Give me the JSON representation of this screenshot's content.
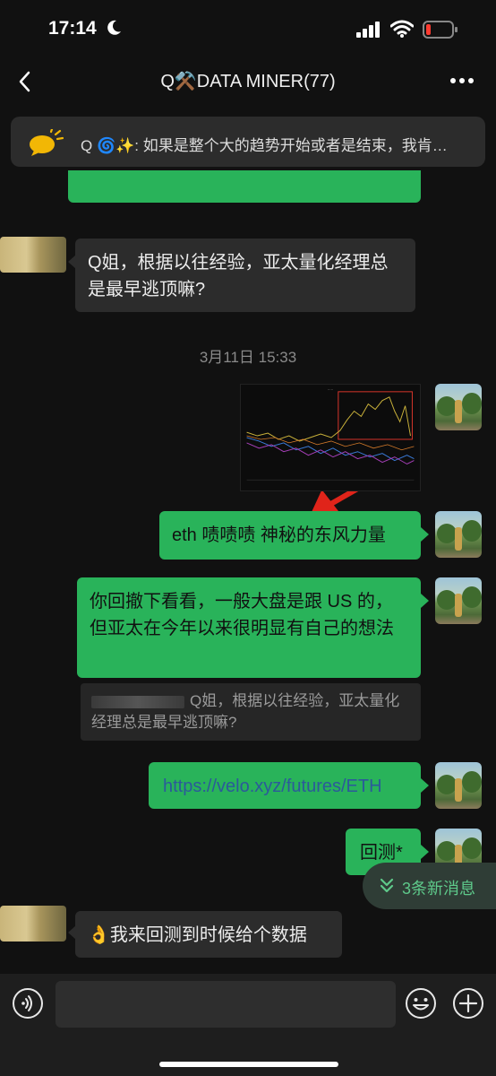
{
  "status_bar": {
    "time": "17:14",
    "battery_color": "#ff3b30"
  },
  "header": {
    "title": "Q⚒️DATA MINER(77)"
  },
  "announcement": {
    "text": "Q 🌀✨: 如果是整个大的趋势开始或者是结束，我肯…"
  },
  "messages": [
    {
      "side": "in",
      "text": "Q姐，根据以往经验，亚太量化经理总是最早逃顶嘛?"
    },
    {
      "type": "timestamp",
      "text": "3月11日 15:33"
    },
    {
      "side": "out",
      "type": "image",
      "icon": "chart-image"
    },
    {
      "side": "out",
      "text": "eth 啧啧啧 神秘的东风力量"
    },
    {
      "side": "out",
      "text": "你回撤下看看，一般大盘是跟 US 的，但亚太在今年以来很明显有自己的想法"
    },
    {
      "type": "quote",
      "text": "Q姐，根据以往经验，亚太量化经理总是最早逃顶嘛?"
    },
    {
      "side": "out",
      "type": "link",
      "text": "https://velo.xyz/futures/ETH"
    },
    {
      "side": "out",
      "text": "回测*"
    },
    {
      "side": "in",
      "text": "👌我来回测到时候给个数据"
    }
  ],
  "new_messages": {
    "label": "3条新消息"
  },
  "input": {
    "placeholder": ""
  },
  "colors": {
    "bubble_out": "#29b35a",
    "bubble_in": "#2c2c2c",
    "link": "#2b5a9a",
    "annotation_arrow": "#e0241a"
  }
}
